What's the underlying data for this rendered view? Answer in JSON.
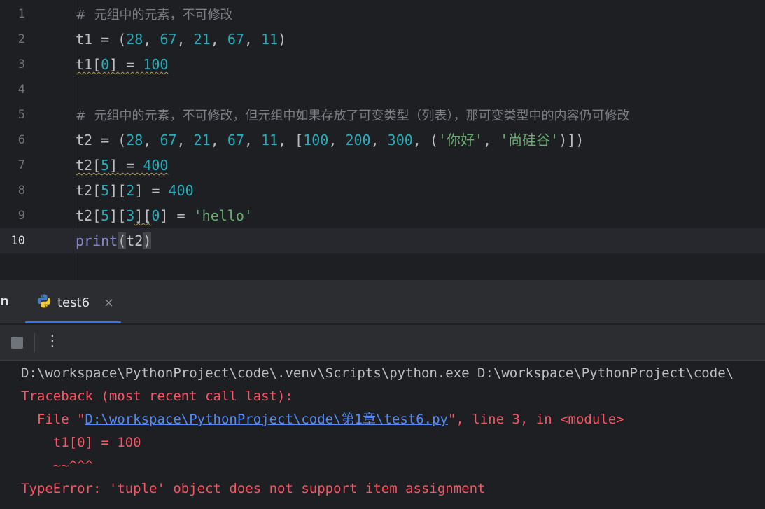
{
  "editor": {
    "lines": [
      {
        "num": "1",
        "tokens": [
          {
            "t": "comment",
            "v": "#  元组中的元素，不可修改"
          }
        ]
      },
      {
        "num": "2",
        "tokens": [
          {
            "t": "plain",
            "v": "t1 = ("
          },
          {
            "t": "num",
            "v": "28"
          },
          {
            "t": "plain",
            "v": ", "
          },
          {
            "t": "num",
            "v": "67"
          },
          {
            "t": "plain",
            "v": ", "
          },
          {
            "t": "num",
            "v": "21"
          },
          {
            "t": "plain",
            "v": ", "
          },
          {
            "t": "num",
            "v": "67"
          },
          {
            "t": "plain",
            "v": ", "
          },
          {
            "t": "num",
            "v": "11"
          },
          {
            "t": "plain",
            "v": ")"
          }
        ]
      },
      {
        "num": "3",
        "tokens": [
          {
            "t": "warn",
            "v": "t1["
          },
          {
            "t": "warnnum",
            "v": "0"
          },
          {
            "t": "warn",
            "v": "] = "
          },
          {
            "t": "warnnum",
            "v": "100"
          }
        ]
      },
      {
        "num": "4",
        "tokens": []
      },
      {
        "num": "5",
        "tokens": [
          {
            "t": "comment",
            "v": "#  元组中的元素，不可修改，但元组中如果存放了可变类型（列表），那可变类型中的内容仍可修改"
          }
        ]
      },
      {
        "num": "6",
        "tokens": [
          {
            "t": "plain",
            "v": "t2 = ("
          },
          {
            "t": "num",
            "v": "28"
          },
          {
            "t": "plain",
            "v": ", "
          },
          {
            "t": "num",
            "v": "67"
          },
          {
            "t": "plain",
            "v": ", "
          },
          {
            "t": "num",
            "v": "21"
          },
          {
            "t": "plain",
            "v": ", "
          },
          {
            "t": "num",
            "v": "67"
          },
          {
            "t": "plain",
            "v": ", "
          },
          {
            "t": "num",
            "v": "11"
          },
          {
            "t": "plain",
            "v": ", ["
          },
          {
            "t": "num",
            "v": "100"
          },
          {
            "t": "plain",
            "v": ", "
          },
          {
            "t": "num",
            "v": "200"
          },
          {
            "t": "plain",
            "v": ", "
          },
          {
            "t": "num",
            "v": "300"
          },
          {
            "t": "plain",
            "v": ", ("
          },
          {
            "t": "str",
            "v": "'你好'"
          },
          {
            "t": "plain",
            "v": ", "
          },
          {
            "t": "str",
            "v": "'尚硅谷'"
          },
          {
            "t": "plain",
            "v": ")])"
          }
        ]
      },
      {
        "num": "7",
        "tokens": [
          {
            "t": "warn",
            "v": "t2["
          },
          {
            "t": "warnnum",
            "v": "5"
          },
          {
            "t": "warn",
            "v": "] = "
          },
          {
            "t": "warnnum",
            "v": "400"
          }
        ]
      },
      {
        "num": "8",
        "tokens": [
          {
            "t": "plain",
            "v": "t2["
          },
          {
            "t": "num",
            "v": "5"
          },
          {
            "t": "plain",
            "v": "]["
          },
          {
            "t": "num",
            "v": "2"
          },
          {
            "t": "plain",
            "v": "] = "
          },
          {
            "t": "num",
            "v": "400"
          }
        ]
      },
      {
        "num": "9",
        "tokens": [
          {
            "t": "plain",
            "v": "t2["
          },
          {
            "t": "num",
            "v": "5"
          },
          {
            "t": "plain",
            "v": "]["
          },
          {
            "t": "num",
            "v": "3"
          },
          {
            "t": "warn",
            "v": "]["
          },
          {
            "t": "num",
            "v": "0"
          },
          {
            "t": "plain",
            "v": "] = "
          },
          {
            "t": "str",
            "v": "'hello'"
          }
        ]
      },
      {
        "num": "10",
        "tokens": [
          {
            "t": "builtin",
            "v": "print"
          },
          {
            "t": "paren",
            "v": "("
          },
          {
            "t": "plain",
            "v": "t2"
          },
          {
            "t": "paren",
            "v": ")"
          }
        ]
      }
    ],
    "current_line": "10"
  },
  "tool_window": {
    "left_label": "n",
    "tab_label": "test6",
    "tab_icon": "python-icon",
    "close_glyph": "×",
    "more_glyph": "⋮"
  },
  "console": {
    "command": "D:\\workspace\\PythonProject\\code\\.venv\\Scripts\\python.exe D:\\workspace\\PythonProject\\code\\",
    "traceback_header": "Traceback (most recent call last):",
    "file_prefix": "  File \"",
    "file_link": "D:\\workspace\\PythonProject\\code\\第1章\\test6.py",
    "file_suffix": "\", line 3, in <module>",
    "code_line": "    t1[0] = 100",
    "marker_line": "    ~~^^^",
    "error_line": "TypeError: 'tuple' object does not support item assignment"
  },
  "colors": {
    "background": "#1e1f22",
    "number": "#2aacb8",
    "string": "#6aab73",
    "error": "#f75464",
    "link": "#548af7",
    "accent": "#3574f0"
  }
}
